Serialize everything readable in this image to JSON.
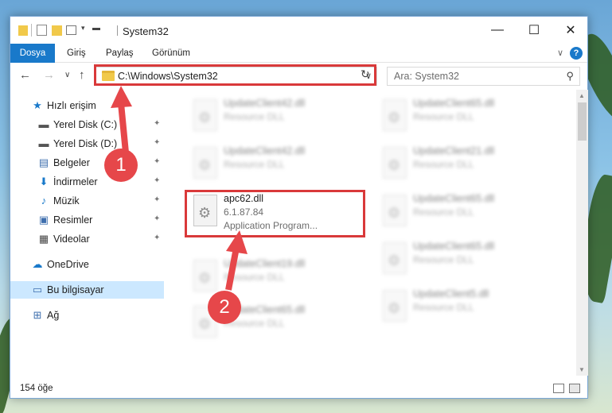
{
  "title": {
    "window_title": "System32",
    "minimize": "—",
    "maximize": "☐",
    "close": "✕"
  },
  "ribbon": {
    "tabs": [
      "Dosya",
      "Giriş",
      "Paylaş",
      "Görünüm"
    ],
    "help": "?"
  },
  "nav": {
    "address": "C:\\Windows\\System32",
    "search_placeholder": "Ara: System32"
  },
  "sidebar": {
    "quick_access": "Hızlı erişim",
    "items": [
      {
        "label": "Yerel Disk (C:)",
        "icon": "drive-icon",
        "pinned": true
      },
      {
        "label": "Yerel Disk (D:)",
        "icon": "drive-icon",
        "pinned": true
      },
      {
        "label": "Belgeler",
        "icon": "documents-icon",
        "pinned": true
      },
      {
        "label": "İndirmeler",
        "icon": "downloads-icon",
        "pinned": true
      },
      {
        "label": "Müzik",
        "icon": "music-icon",
        "pinned": true
      },
      {
        "label": "Resimler",
        "icon": "pictures-icon",
        "pinned": true
      },
      {
        "label": "Videolar",
        "icon": "videos-icon",
        "pinned": true
      }
    ],
    "onedrive": "OneDrive",
    "this_pc": "Bu bilgisayar",
    "network": "Ağ"
  },
  "files": {
    "left": [
      {
        "name": "UpdateClient42.dll",
        "type": "Resource DLL",
        "blurred": true
      },
      {
        "name": "UpdateClient42.dll",
        "type": "Resource DLL",
        "blurred": true
      },
      {
        "name": "apc62.dll",
        "version": "6.1.87.84",
        "type": "Application Program...",
        "blurred": false
      },
      {
        "name": "UpdateClient19.dll",
        "type": "Resource DLL",
        "blurred": true
      },
      {
        "name": "UpdateClient65.dll",
        "type": "Resource DLL",
        "blurred": true
      }
    ],
    "right": [
      {
        "name": "UpdateClient65.dll",
        "type": "Resource DLL"
      },
      {
        "name": "UpdateClient21.dll",
        "type": "Resource DLL"
      },
      {
        "name": "UpdateClient65.dll",
        "type": "Resource DLL"
      },
      {
        "name": "UpdateClient65.dll",
        "type": "Resource DLL"
      },
      {
        "name": "UpdateClient5.dll",
        "type": "Resource DLL"
      }
    ]
  },
  "status": {
    "item_count": "154 öğe"
  },
  "annotations": {
    "step1": "1",
    "step2": "2",
    "color": "#e6474a"
  }
}
